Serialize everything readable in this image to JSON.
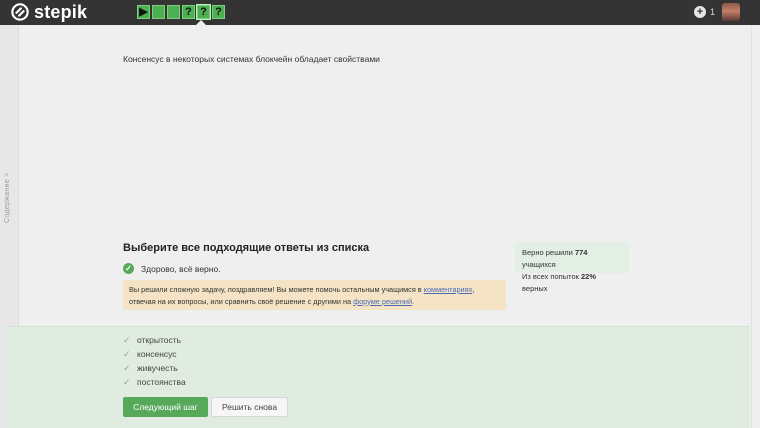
{
  "app": {
    "name": "stepik"
  },
  "steps": [
    {
      "symbol": "▶",
      "state": "done"
    },
    {
      "symbol": "",
      "state": "done"
    },
    {
      "symbol": "",
      "state": "done"
    },
    {
      "symbol": "?",
      "state": "done"
    },
    {
      "symbol": "?",
      "state": "current"
    },
    {
      "symbol": "?",
      "state": "done"
    }
  ],
  "header": {
    "notification_count": "1"
  },
  "sidebar": {
    "label": "Содержание >"
  },
  "question": {
    "text": "Консенсус в некоторых системах блокчейн обладает свойствами"
  },
  "task": {
    "heading": "Выберите все подходящие ответы из списка",
    "result_text": "Здорово, всё верно."
  },
  "alert": {
    "part1": "Вы решили сложную задачу, поздравляем! Вы можете помочь остальным учащимся в ",
    "link1": "комментариях",
    "part2": ", отвечая на их вопросы, или сравнить своё решение с другими на ",
    "link2": "форуме решений",
    "part3": "."
  },
  "stats": {
    "line1_prefix": "Верно решили ",
    "solved_count": "774",
    "line1_suffix": " учащихся",
    "line2_prefix": "Из всех попыток ",
    "percent": "22%",
    "line2_suffix": " верных"
  },
  "options": [
    {
      "label": "открытость",
      "checked": true
    },
    {
      "label": "консенсус",
      "checked": true
    },
    {
      "label": "живучесть",
      "checked": true
    },
    {
      "label": "постоянства",
      "checked": true
    }
  ],
  "buttons": {
    "next": "Следующий шаг",
    "retry": "Решить снова"
  },
  "colors": {
    "topbar": "#343434",
    "accent_green": "#57a95a",
    "answers_panel": "#e1ece1",
    "alert_bg": "#f4e3c4",
    "link": "#4a6db7"
  }
}
